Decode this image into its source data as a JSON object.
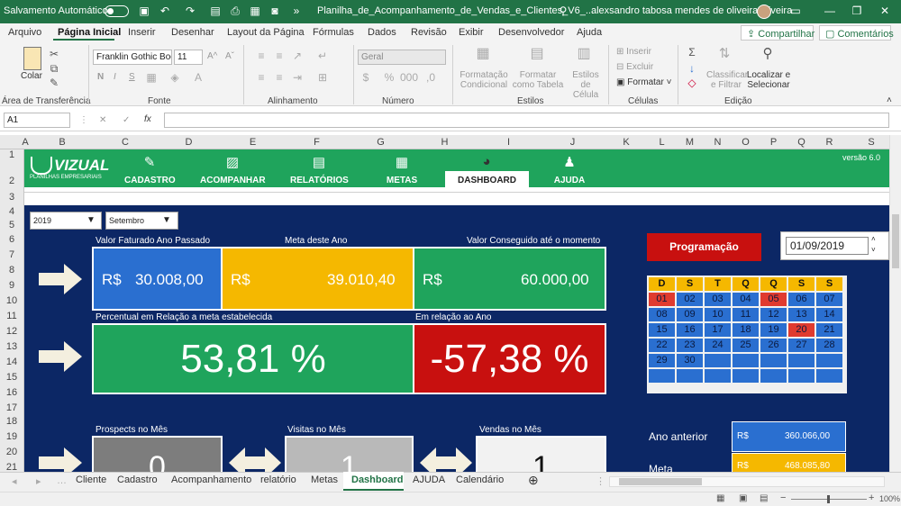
{
  "titlebar": {
    "autosave_label": "Salvamento Automático",
    "filename": "Planilha_de_Acompanhamento_de_Vendas_e_Clientes_V6_...",
    "user": "alexsandro tabosa mendes de oliveira oliveira"
  },
  "ribbon_tabs": [
    "Arquivo",
    "Página Inicial",
    "Inserir",
    "Desenhar",
    "Layout da Página",
    "Fórmulas",
    "Dados",
    "Revisão",
    "Exibir",
    "Desenvolvedor",
    "Ajuda"
  ],
  "share_label": "Compartilhar",
  "comments_label": "Comentários",
  "ribbon": {
    "paste_label": "Colar",
    "font_name": "Franklin Gothic Boo",
    "font_size": "11",
    "number_format": "Geral",
    "bold": "N",
    "italic": "I",
    "underline": "S",
    "cond_format": "Formatação Condicional",
    "format_table": "Formatar como Tabela",
    "cell_styles": "Estilos de Célula",
    "insert": "Inserir",
    "delete": "Excluir",
    "format": "Formatar",
    "sort_filter": "Classificar e Filtrar",
    "find_select": "Localizar e Selecionar",
    "groups": [
      "Área de Transferência",
      "Fonte",
      "Alinhamento",
      "Número",
      "Estilos",
      "Células",
      "Edição"
    ]
  },
  "namebox": "A1",
  "columns": [
    "A",
    "B",
    "C",
    "D",
    "E",
    "F",
    "G",
    "H",
    "I",
    "J",
    "K",
    "L",
    "M",
    "N",
    "O",
    "P",
    "Q",
    "R",
    "S"
  ],
  "rows": [
    "1",
    "2",
    "3",
    "4",
    "5",
    "6",
    "7",
    "8",
    "9",
    "10",
    "11",
    "12",
    "13",
    "14",
    "15",
    "16",
    "17",
    "18",
    "19",
    "20",
    "21"
  ],
  "header": {
    "logo": "VIZUAL",
    "logo_sub": "PLANILHAS EMPRESARIAIS",
    "version": "versão 6.0",
    "nav": [
      "CADASTRO",
      "ACOMPANHAR",
      "RELATÓRIOS",
      "METAS",
      "DASHBOARD",
      "AJUDA"
    ]
  },
  "dashboard": {
    "year": "2019",
    "month": "Setembro",
    "label_last_year": "Valor Faturado Ano Passado",
    "label_goal": "Meta deste Ano",
    "label_achieved": "Valor Conseguido até o momento",
    "currency": "R$",
    "value_last_year": "30.008,00",
    "value_goal": "39.010,40",
    "value_achieved": "60.000,00",
    "label_pct_goal": "Percentual em Relação a meta estabelecida",
    "label_pct_year": "Em relação ao Ano",
    "pct_goal": "53,81 %",
    "pct_year": "-57,38 %",
    "label_prospects": "Prospects no Mês",
    "label_visits": "Visitas no Mês",
    "label_sales": "Vendas no Mês",
    "prospects": "0",
    "visits": "1",
    "sales": "1",
    "program_button": "Programação",
    "date": "01/09/2019",
    "label_prev_year": "Ano anterior",
    "prev_year_value": "360.066,00",
    "label_meta": "Meta",
    "meta_value": "468.085,80"
  },
  "calendar": {
    "weekdays": [
      "D",
      "S",
      "T",
      "Q",
      "Q",
      "S",
      "S"
    ],
    "days": [
      [
        "01",
        "02",
        "03",
        "04",
        "05",
        "06",
        "07"
      ],
      [
        "08",
        "09",
        "10",
        "11",
        "12",
        "13",
        "14"
      ],
      [
        "15",
        "16",
        "17",
        "18",
        "19",
        "20",
        "21"
      ],
      [
        "22",
        "23",
        "24",
        "25",
        "26",
        "27",
        "28"
      ],
      [
        "29",
        "30",
        "",
        "",
        "",
        "",
        ""
      ],
      [
        "",
        "",
        "",
        "",
        "",
        "",
        ""
      ]
    ],
    "highlight": [
      "01",
      "05",
      "20"
    ]
  },
  "sheet_tabs": [
    "Cliente",
    "Cadastro",
    "Acompanhamento",
    "relatório",
    "Metas",
    "Dashboard",
    "AJUDA",
    "Calendário"
  ],
  "zoom": "100%"
}
